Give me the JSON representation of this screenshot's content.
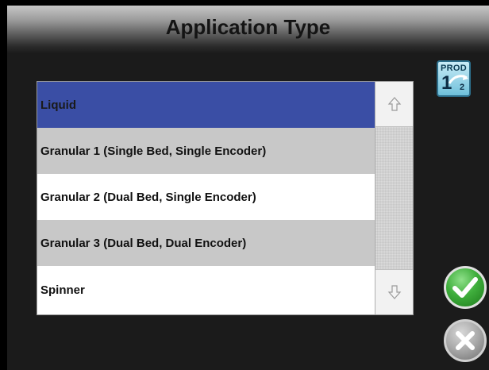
{
  "header": {
    "title": "Application Type"
  },
  "product_badge": {
    "label": "PROD",
    "current": "1",
    "total": "2"
  },
  "application_types": {
    "items": [
      {
        "label": "Liquid",
        "state": "selected"
      },
      {
        "label": "Granular 1 (Single Bed, Single Encoder)",
        "state": "normal"
      },
      {
        "label": "Granular 2 (Dual Bed, Single Encoder)",
        "state": "normal"
      },
      {
        "label": "Granular 3 (Dual Bed, Dual Encoder)",
        "state": "normal"
      },
      {
        "label": "Spinner",
        "state": "normal"
      }
    ]
  },
  "scrollbar": {
    "up_icon": "arrow-up-icon",
    "down_icon": "arrow-down-icon"
  },
  "actions": {
    "accept_icon": "checkmark-icon",
    "cancel_icon": "x-icon"
  },
  "colors": {
    "selected_row": "#3a4ea5",
    "alt_row": "#c8c8c8",
    "accept_green": "#3fae3c",
    "cancel_gray": "#a8a8a8",
    "background": "#1b1b1b"
  }
}
